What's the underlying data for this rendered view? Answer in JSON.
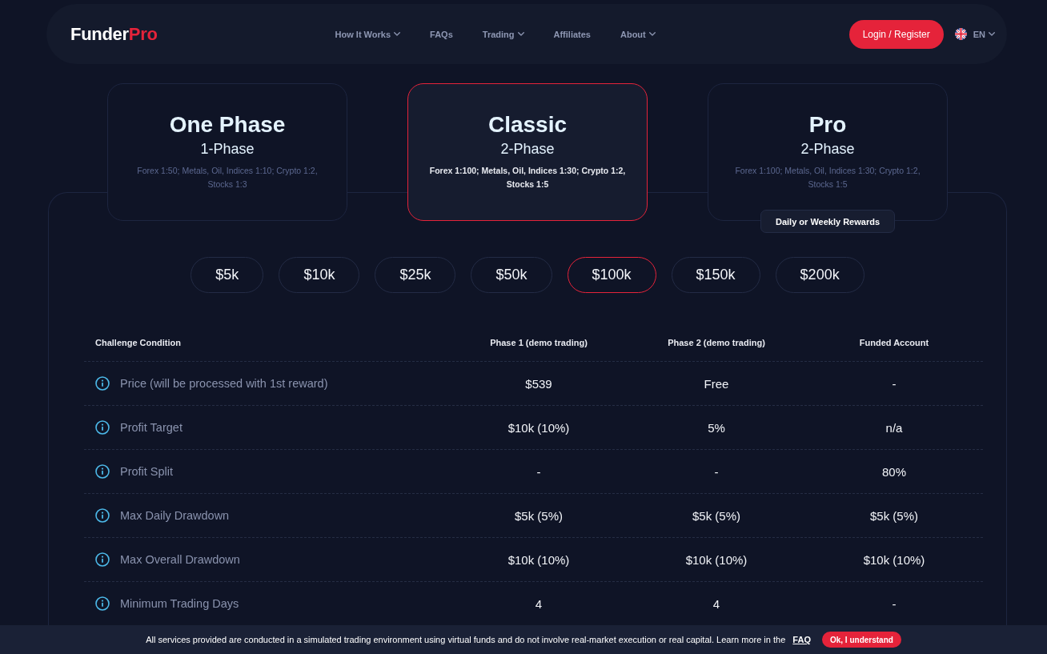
{
  "header": {
    "logo": {
      "primary": "Funder",
      "accent": "Pro"
    },
    "nav": [
      {
        "label": "How It Works",
        "dropdown": true
      },
      {
        "label": "FAQs",
        "dropdown": false
      },
      {
        "label": "Trading",
        "dropdown": true
      },
      {
        "label": "Affiliates",
        "dropdown": false
      },
      {
        "label": "About",
        "dropdown": true
      }
    ],
    "login_button": "Login / Register",
    "language": "EN"
  },
  "plans": [
    {
      "title": "One Phase",
      "subtitle": "1-Phase",
      "leverage": "Forex 1:50; Metals, Oil, Indices 1:10; Crypto 1:2, Stocks 1:3",
      "selected": false
    },
    {
      "title": "Classic",
      "subtitle": "2-Phase",
      "leverage": "Forex 1:100; Metals, Oil, Indices 1:30; Crypto 1:2, Stocks 1:5",
      "selected": true
    },
    {
      "title": "Pro",
      "subtitle": "2-Phase",
      "leverage": "Forex 1:100; Metals, Oil, Indices 1:30; Crypto 1:2, Stocks 1:5",
      "selected": false,
      "badge": "Daily or Weekly Rewards"
    }
  ],
  "account_sizes": [
    {
      "label": "$5k",
      "selected": false
    },
    {
      "label": "$10k",
      "selected": false
    },
    {
      "label": "$25k",
      "selected": false
    },
    {
      "label": "$50k",
      "selected": false
    },
    {
      "label": "$100k",
      "selected": true
    },
    {
      "label": "$150k",
      "selected": false
    },
    {
      "label": "$200k",
      "selected": false
    }
  ],
  "table": {
    "columns": [
      "Challenge Condition",
      "Phase 1 (demo trading)",
      "Phase 2 (demo trading)",
      "Funded Account"
    ],
    "rows": [
      {
        "cells": [
          "Price (will be processed with 1st reward)",
          "$539",
          "Free",
          "-"
        ]
      },
      {
        "cells": [
          "Profit Target",
          "$10k (10%)",
          "5%",
          "n/a"
        ]
      },
      {
        "cells": [
          "Profit Split",
          "-",
          "-",
          "80%"
        ]
      },
      {
        "cells": [
          "Max Daily Drawdown",
          "$5k (5%)",
          "$5k (5%)",
          "$5k (5%)"
        ]
      },
      {
        "cells": [
          "Max Overall Drawdown",
          "$10k (10%)",
          "$10k (10%)",
          "$10k (10%)"
        ]
      },
      {
        "cells": [
          "Minimum Trading Days",
          "4",
          "4",
          "-"
        ]
      }
    ]
  },
  "notice": {
    "text": "All services provided are conducted in a simulated trading environment using virtual funds and do not involve real-market execution or real capital. Learn more in the",
    "link": "FAQ",
    "button": "Ok, I understand"
  }
}
